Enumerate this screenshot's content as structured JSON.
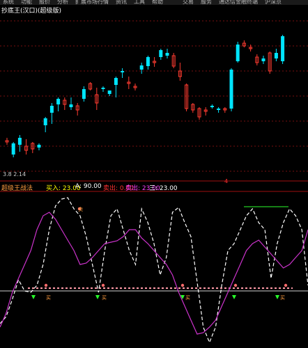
{
  "menu": {
    "items": [
      "系统",
      "功能",
      "报价",
      "分析",
      "扩展市场行情",
      "资讯",
      "工具",
      "帮助",
      "",
      "交易",
      "服务",
      "通达信金融终端",
      "沪深京"
    ]
  },
  "main_panel": {
    "title": "抄底王(汉口)(超级版)",
    "bottom_left_label": "3.8 2.14",
    "bottom_marker": "4"
  },
  "indicator_panel": {
    "title": "超级王战法",
    "labels": [
      {
        "text": "买入: 23.00",
        "color": "#ffff00"
      },
      {
        "text": "A: 90.00",
        "color": "#ffffff"
      },
      {
        "text": "卖出: 0.00",
        "color": "#ff3030"
      },
      {
        "text": "卖出: 23.00",
        "color": "#ff40ff"
      },
      {
        "text": "三: 23.00",
        "color": "#ffffff"
      }
    ],
    "annotations": [
      "卖",
      "买",
      "买",
      "买",
      "买"
    ]
  },
  "chart_data": [
    {
      "type": "candlestick",
      "title": "抄底王(汉口)(超级版)",
      "candles": [
        {
          "o": 204,
          "h": 208,
          "l": 198,
          "c": 202,
          "up": false
        },
        {
          "o": 222,
          "h": 226,
          "l": 204,
          "c": 206,
          "up": true
        },
        {
          "o": 208,
          "h": 218,
          "l": 194,
          "c": 198,
          "up": true
        },
        {
          "o": 210,
          "h": 222,
          "l": 200,
          "c": 216,
          "up": false
        },
        {
          "o": 214,
          "h": 220,
          "l": 204,
          "c": 206,
          "up": false
        },
        {
          "o": 212,
          "h": 216,
          "l": 206,
          "c": 208,
          "up": true
        },
        {
          "o": 180,
          "h": 190,
          "l": 168,
          "c": 170,
          "up": true
        },
        {
          "o": 162,
          "h": 178,
          "l": 148,
          "c": 152,
          "up": true
        },
        {
          "o": 150,
          "h": 160,
          "l": 140,
          "c": 142,
          "up": true
        },
        {
          "o": 150,
          "h": 158,
          "l": 140,
          "c": 144,
          "up": false
        },
        {
          "o": 150,
          "h": 158,
          "l": 140,
          "c": 154,
          "up": true
        },
        {
          "o": 158,
          "h": 166,
          "l": 148,
          "c": 152,
          "up": false
        },
        {
          "o": 142,
          "h": 146,
          "l": 124,
          "c": 128,
          "up": true
        },
        {
          "o": 120,
          "h": 130,
          "l": 118,
          "c": 128,
          "up": false
        },
        {
          "o": 148,
          "h": 158,
          "l": 126,
          "c": 136,
          "up": false
        },
        {
          "o": 128,
          "h": 132,
          "l": 124,
          "c": 126,
          "up": true
        },
        {
          "o": 135,
          "h": 138,
          "l": 130,
          "c": 130,
          "up": true
        },
        {
          "o": 122,
          "h": 140,
          "l": 110,
          "c": 112,
          "up": true
        },
        {
          "o": 104,
          "h": 112,
          "l": 98,
          "c": 102,
          "up": true
        },
        {
          "o": 120,
          "h": 128,
          "l": 110,
          "c": 118,
          "up": false
        },
        {
          "o": 126,
          "h": 130,
          "l": 120,
          "c": 124,
          "up": false
        },
        {
          "o": 100,
          "h": 106,
          "l": 90,
          "c": 94,
          "up": true
        },
        {
          "o": 95,
          "h": 100,
          "l": 80,
          "c": 82,
          "up": true
        },
        {
          "o": 90,
          "h": 96,
          "l": 82,
          "c": 88,
          "up": false
        },
        {
          "o": 82,
          "h": 86,
          "l": 70,
          "c": 72,
          "up": true
        },
        {
          "o": 76,
          "h": 84,
          "l": 70,
          "c": 80,
          "up": true
        },
        {
          "o": 95,
          "h": 98,
          "l": 76,
          "c": 80,
          "up": false
        },
        {
          "o": 110,
          "h": 116,
          "l": 90,
          "c": 102,
          "up": false
        },
        {
          "o": 156,
          "h": 160,
          "l": 120,
          "c": 122,
          "up": false
        },
        {
          "o": 158,
          "h": 162,
          "l": 148,
          "c": 150,
          "up": false
        },
        {
          "o": 168,
          "h": 172,
          "l": 154,
          "c": 156,
          "up": false
        },
        {
          "o": 160,
          "h": 166,
          "l": 154,
          "c": 158,
          "up": false
        },
        {
          "o": 152,
          "h": 156,
          "l": 150,
          "c": 154,
          "up": true
        },
        {
          "o": 158,
          "h": 162,
          "l": 154,
          "c": 156,
          "up": true
        },
        {
          "o": 158,
          "h": 162,
          "l": 154,
          "c": 156,
          "up": false
        },
        {
          "o": 156,
          "h": 160,
          "l": 98,
          "c": 100,
          "up": true
        },
        {
          "o": 88,
          "h": 90,
          "l": 60,
          "c": 64,
          "up": true
        },
        {
          "o": 62,
          "h": 68,
          "l": 58,
          "c": 66,
          "up": false
        },
        {
          "o": 70,
          "h": 74,
          "l": 64,
          "c": 68,
          "up": false
        },
        {
          "o": 90,
          "h": 94,
          "l": 78,
          "c": 82,
          "up": false
        },
        {
          "o": 88,
          "h": 92,
          "l": 80,
          "c": 84,
          "up": true
        },
        {
          "o": 102,
          "h": 106,
          "l": 74,
          "c": 76,
          "up": false
        },
        {
          "o": 84,
          "h": 88,
          "l": 70,
          "c": 76,
          "up": true
        },
        {
          "o": 88,
          "h": 92,
          "l": 50,
          "c": 52,
          "up": true
        }
      ]
    },
    {
      "type": "line",
      "title": "超级王战法",
      "series": [
        {
          "color": "#ffffff",
          "style": "dashed",
          "values": [
            465,
            455,
            430,
            402,
            418,
            420,
            410,
            380,
            330,
            296,
            286,
            284,
            300,
            310,
            340,
            380,
            420,
            360,
            310,
            300,
            330,
            360,
            380,
            300,
            320,
            350,
            395,
            370,
            305,
            298,
            320,
            340,
            405,
            470,
            492,
            470,
            410,
            360,
            350,
            330,
            310,
            300,
            320,
            330,
            400,
            350,
            320,
            300,
            310,
            330,
            410
          ]
        },
        {
          "color": "#cc33cc",
          "style": "solid",
          "values": [
            470,
            450,
            420,
            400,
            380,
            360,
            330,
            310,
            305,
            315,
            330,
            345,
            360,
            380,
            378,
            370,
            360,
            350,
            348,
            346,
            340,
            330,
            330,
            342,
            350,
            360,
            370,
            380,
            395,
            420,
            440,
            460,
            480,
            478,
            470,
            460,
            440,
            420,
            400,
            380,
            360,
            350,
            345,
            355,
            365,
            375,
            385,
            380,
            370,
            360,
            330
          ]
        }
      ]
    }
  ]
}
